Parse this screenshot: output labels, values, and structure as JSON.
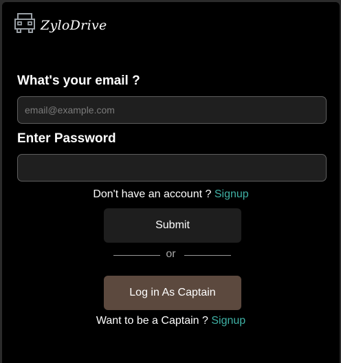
{
  "brand": {
    "name": "ZyloDrive",
    "icon": "car-front-icon"
  },
  "email": {
    "label": "What's your email ?",
    "placeholder": "email@example.com",
    "value": ""
  },
  "password": {
    "label": "Enter Password",
    "value": ""
  },
  "signup_prompt": {
    "text": "Don't have an account ?",
    "link": "Signup"
  },
  "submit_label": "Submit",
  "divider_text": "or",
  "captain_button_label": "Log in As Captain",
  "captain_prompt": {
    "text": "Want to be a Captain ?",
    "link": "Signup"
  },
  "colors": {
    "background": "#000000",
    "link": "#3fb1a5",
    "captain_button": "#5c493e",
    "submit_button": "#1e1e1e",
    "input_bg": "#1f1f1f"
  }
}
